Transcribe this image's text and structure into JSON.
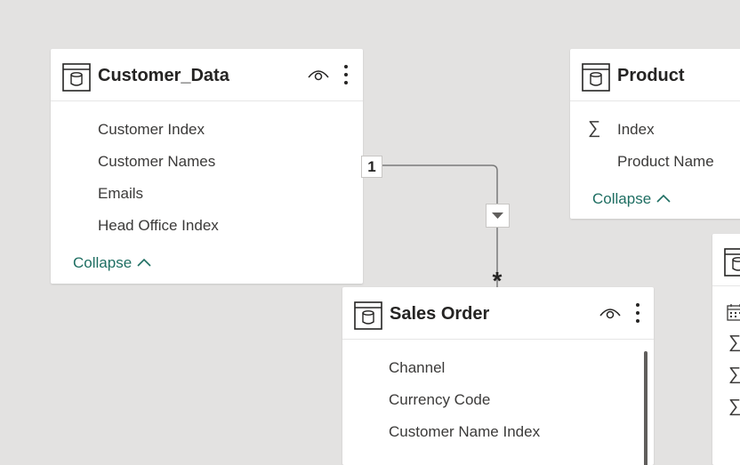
{
  "tables": {
    "customer_data": {
      "title": "Customer_Data",
      "fields": [
        "Customer Index",
        "Customer Names",
        "Emails",
        "Head Office Index"
      ],
      "collapse_label": "Collapse"
    },
    "product": {
      "title": "Product",
      "fields": [
        "Index",
        "Product Name"
      ],
      "field_types": [
        "sum",
        "text"
      ],
      "collapse_label": "Collapse"
    },
    "sales_order": {
      "title": "Sales Order",
      "fields": [
        "Channel",
        "Currency Code",
        "Customer Name Index"
      ]
    },
    "partial_table": {
      "field_types": [
        "calendar",
        "sum",
        "sum",
        "sum"
      ]
    }
  },
  "relationship": {
    "one_side": "1",
    "many_side": "*",
    "filter_direction": "single"
  },
  "colors": {
    "canvas": "#e3e2e1",
    "accent_link": "#1e6e62",
    "line": "#7a7a7a"
  },
  "icons": {
    "table": "table-icon",
    "visibility": "eye-icon",
    "more": "more-options-icon",
    "sum": "sigma-icon",
    "calendar": "calendar-icon"
  }
}
